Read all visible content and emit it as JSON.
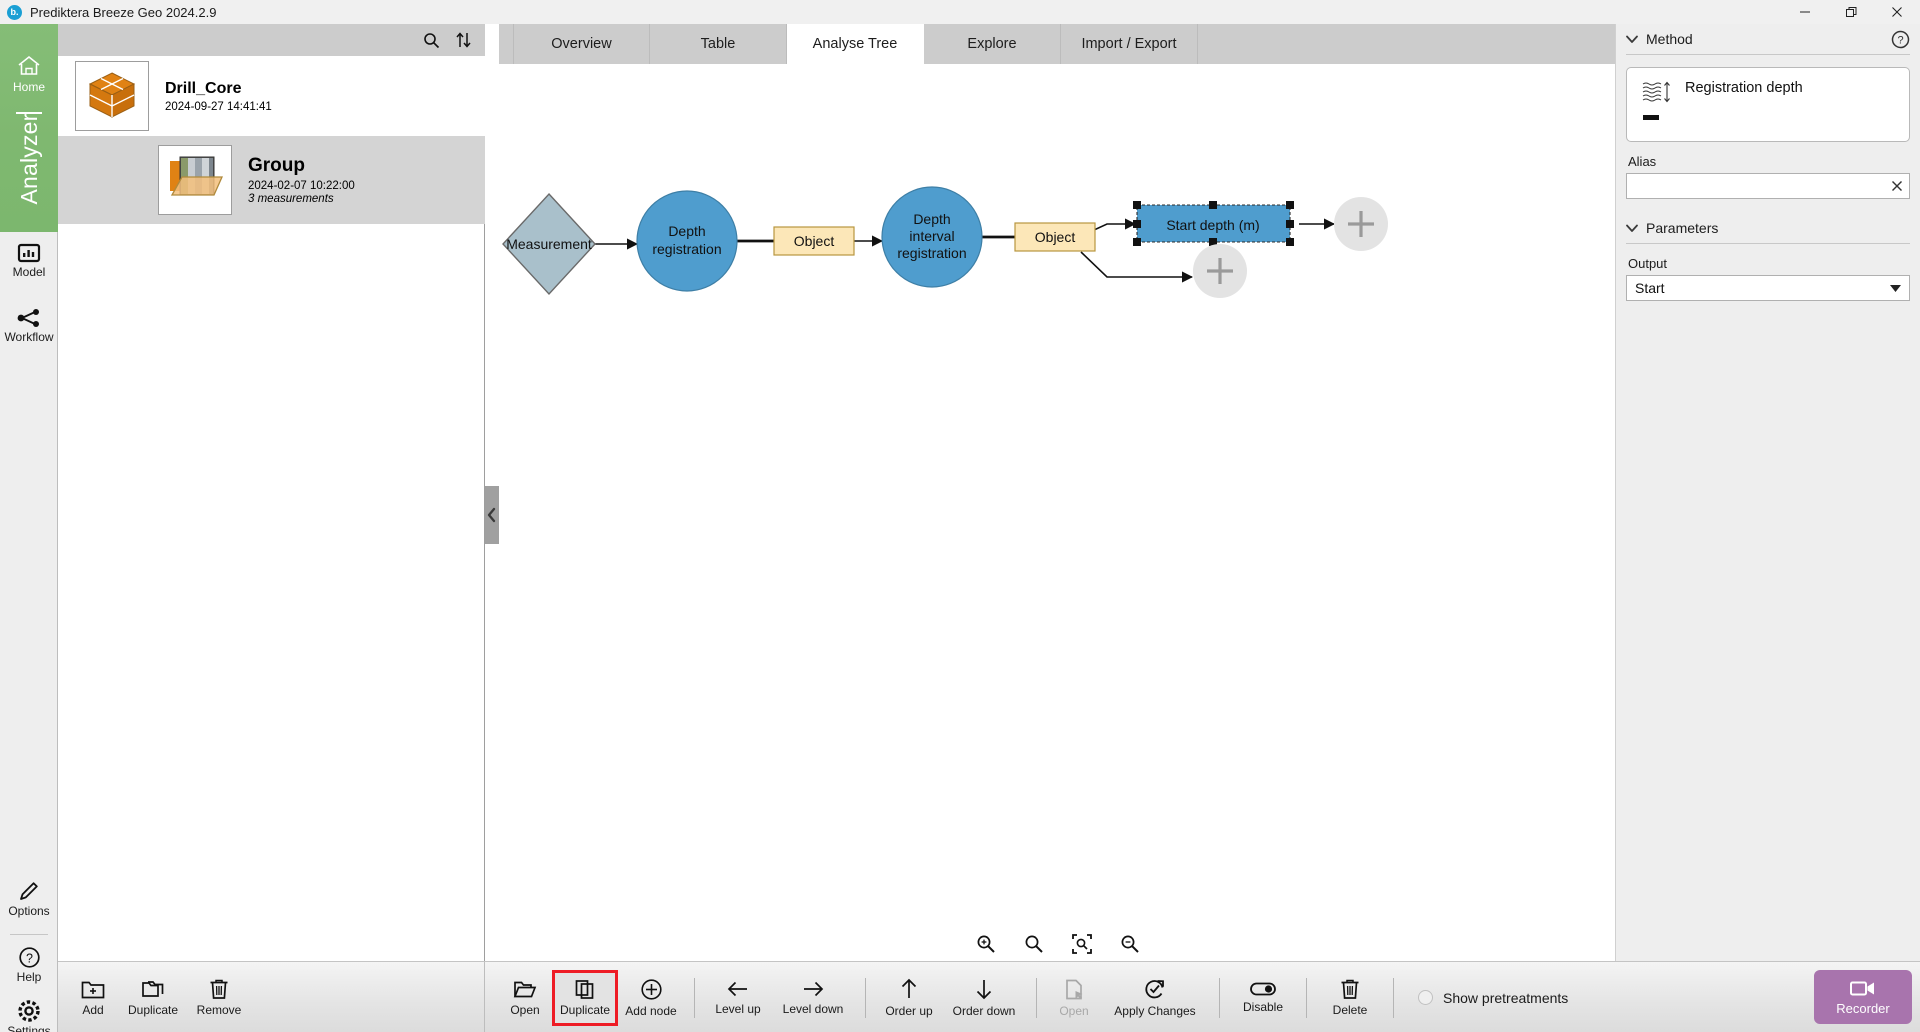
{
  "window": {
    "title": "Prediktera Breeze Geo 2024.2.9",
    "logo_letter": "b.",
    "minimize_label": "—",
    "maximize_label": "❐",
    "close_label": "✕"
  },
  "rail": {
    "home": {
      "label": "Home",
      "icon": "home-icon"
    },
    "brand": "Analyzer",
    "items": [
      {
        "label": "Model",
        "icon": "model-chart-icon"
      },
      {
        "label": "Workflow",
        "icon": "workflow-nodes-icon"
      }
    ],
    "bottom_items": [
      {
        "label": "Options",
        "icon": "pencil-icon"
      },
      {
        "label": "Help",
        "icon": "question-circle-icon"
      },
      {
        "label": "Settings",
        "icon": "gear-icon"
      }
    ]
  },
  "explorer": {
    "toolbar": {
      "search_icon": "search-icon",
      "sort_icon": "sort-updown-icon"
    },
    "nodes": [
      {
        "name": "Drill_Core",
        "timestamp": "2024-09-27 14:41:41",
        "detail": "",
        "icon": "cube-icon",
        "selected": false
      },
      {
        "name": "Group",
        "timestamp": "2024-02-07 10:22:00",
        "detail": "3 measurements",
        "icon": "folder-image-icon",
        "selected": true
      }
    ]
  },
  "tabs": [
    {
      "label": "Overview",
      "active": false
    },
    {
      "label": "Table",
      "active": false
    },
    {
      "label": "Analyse Tree",
      "active": true
    },
    {
      "label": "Explore",
      "active": false
    },
    {
      "label": "Import / Export",
      "active": false
    }
  ],
  "tree": {
    "nodes": [
      {
        "id": "measurement",
        "label": "Measurement",
        "shape": "diamond",
        "color": "#a9c0cb"
      },
      {
        "id": "depth_registration",
        "label": "Depth registration",
        "shape": "circle",
        "color": "#4f9dce"
      },
      {
        "id": "object_1",
        "label": "Object",
        "shape": "rect",
        "color": "#fce7b8"
      },
      {
        "id": "depth_interval_registration",
        "label": "Depth interval registration",
        "shape": "circle",
        "color": "#4f9dce"
      },
      {
        "id": "object_2",
        "label": "Object",
        "shape": "rect",
        "color": "#fce7b8"
      },
      {
        "id": "start_depth",
        "label": "Start depth (m)",
        "shape": "rect",
        "color": "#4f9dce",
        "selected": true
      },
      {
        "id": "add_1",
        "label": "+",
        "shape": "circle-add",
        "color": "#e3e3e3"
      },
      {
        "id": "add_2",
        "label": "+",
        "shape": "circle-add",
        "color": "#e3e3e3"
      }
    ],
    "collapse_left_icon": "chevron-left-icon",
    "collapse_right_icon": "chevron-right-icon",
    "zoom_controls": [
      {
        "name": "zoom-in-icon",
        "label": "Zoom in"
      },
      {
        "name": "zoom-reset-icon",
        "label": "Zoom 100%"
      },
      {
        "name": "zoom-fit-icon",
        "label": "Zoom to fit"
      },
      {
        "name": "zoom-out-icon",
        "label": "Zoom out"
      }
    ]
  },
  "right_panel": {
    "method_section": {
      "title": "Method",
      "help_icon": "question-circle-icon",
      "chevron": "chevron-down-icon"
    },
    "method_card": {
      "name": "Registration depth",
      "icon": "registration-depth-icon",
      "value": "▬"
    },
    "alias": {
      "label": "Alias",
      "value": "",
      "placeholder": "",
      "clear_icon": "clear-x-icon"
    },
    "parameters_section": {
      "title": "Parameters",
      "chevron": "chevron-down-icon"
    },
    "output": {
      "label": "Output",
      "value": "Start",
      "caret_icon": "caret-down-icon"
    }
  },
  "bottom_bar": {
    "explorer_actions": [
      {
        "label": "Add",
        "icon": "folder-plus-icon",
        "disabled": false
      },
      {
        "label": "Duplicate",
        "icon": "folders-icon",
        "disabled": false
      },
      {
        "label": "Remove",
        "icon": "trash-icon",
        "disabled": false
      }
    ],
    "tree_actions": [
      {
        "label": "Open",
        "icon": "folder-open-icon",
        "disabled": false,
        "highlighted": false
      },
      {
        "label": "Duplicate",
        "icon": "copy-icon",
        "disabled": false,
        "highlighted": true
      },
      {
        "label": "Add node",
        "icon": "plus-circle-icon",
        "disabled": false,
        "highlighted": false
      },
      {
        "sep": true
      },
      {
        "label": "Level up",
        "icon": "arrow-left-icon",
        "disabled": false,
        "highlighted": false
      },
      {
        "label": "Level down",
        "icon": "arrow-right-icon",
        "disabled": false,
        "highlighted": false
      },
      {
        "sep": true
      },
      {
        "label": "Order up",
        "icon": "arrow-up-icon",
        "disabled": false,
        "highlighted": false
      },
      {
        "label": "Order down",
        "icon": "arrow-down-icon",
        "disabled": false,
        "highlighted": false
      },
      {
        "sep": true
      },
      {
        "label": "Open",
        "icon": "document-cursor-icon",
        "disabled": true,
        "highlighted": false
      },
      {
        "label": "Apply Changes",
        "icon": "refresh-check-icon",
        "disabled": false,
        "highlighted": false
      },
      {
        "sep": true
      },
      {
        "label": "Disable",
        "icon": "toggle-icon",
        "disabled": false,
        "highlighted": false
      },
      {
        "sep": true
      },
      {
        "label": "Delete",
        "icon": "trash-icon",
        "disabled": false,
        "highlighted": false
      },
      {
        "sep": true
      }
    ],
    "show_pretreatments": {
      "label": "Show pretreatments",
      "checked": false
    },
    "recorder": {
      "label": "Recorder",
      "icon": "video-camera-icon",
      "color": "#a874ad"
    }
  },
  "colors": {
    "brand_green": "#7fb870",
    "node_blue": "#4f9dce",
    "node_yellow": "#fce7b8",
    "node_gray_blue": "#a9c0cb",
    "highlight_red": "#ee1c25",
    "recorder_purple": "#a874ad"
  }
}
